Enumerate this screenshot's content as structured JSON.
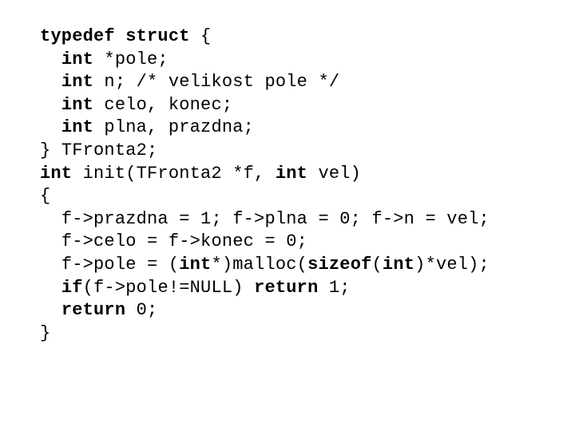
{
  "code": {
    "lines": [
      {
        "indent": 0,
        "tokens": [
          {
            "t": "typedef ",
            "kw": true
          },
          {
            "t": "struct ",
            "kw": true
          },
          {
            "t": "{",
            "kw": false
          }
        ]
      },
      {
        "indent": 1,
        "tokens": [
          {
            "t": "int ",
            "kw": true
          },
          {
            "t": "*pole;",
            "kw": false
          }
        ]
      },
      {
        "indent": 1,
        "tokens": [
          {
            "t": "int ",
            "kw": true
          },
          {
            "t": "n; /* velikost pole */",
            "kw": false
          }
        ]
      },
      {
        "indent": 1,
        "tokens": [
          {
            "t": "int ",
            "kw": true
          },
          {
            "t": "celo, konec;",
            "kw": false
          }
        ]
      },
      {
        "indent": 1,
        "tokens": [
          {
            "t": "int ",
            "kw": true
          },
          {
            "t": "plna, prazdna;",
            "kw": false
          }
        ]
      },
      {
        "indent": 0,
        "tokens": [
          {
            "t": "} TFronta2;",
            "kw": false
          }
        ]
      },
      {
        "indent": 0,
        "tokens": [
          {
            "t": "",
            "kw": false
          }
        ]
      },
      {
        "indent": 0,
        "tokens": [
          {
            "t": "int ",
            "kw": true
          },
          {
            "t": "init(TFronta2 *f, ",
            "kw": false
          },
          {
            "t": "int ",
            "kw": true
          },
          {
            "t": "vel)",
            "kw": false
          }
        ]
      },
      {
        "indent": 0,
        "tokens": [
          {
            "t": "{",
            "kw": false
          }
        ]
      },
      {
        "indent": 1,
        "tokens": [
          {
            "t": "f->prazdna = 1; f->plna = 0; f->n = vel;",
            "kw": false
          }
        ]
      },
      {
        "indent": 1,
        "tokens": [
          {
            "t": "f->celo = f->konec = 0;",
            "kw": false
          }
        ]
      },
      {
        "indent": 1,
        "tokens": [
          {
            "t": "f->pole = (",
            "kw": false
          },
          {
            "t": "int",
            "kw": true
          },
          {
            "t": "*)malloc(",
            "kw": false
          },
          {
            "t": "sizeof",
            "kw": true
          },
          {
            "t": "(",
            "kw": false
          },
          {
            "t": "int",
            "kw": true
          },
          {
            "t": ")*vel);",
            "kw": false
          }
        ]
      },
      {
        "indent": 1,
        "tokens": [
          {
            "t": "if",
            "kw": true
          },
          {
            "t": "(f->pole!=NULL) ",
            "kw": false
          },
          {
            "t": "return ",
            "kw": true
          },
          {
            "t": "1;",
            "kw": false
          }
        ]
      },
      {
        "indent": 1,
        "tokens": [
          {
            "t": "return ",
            "kw": true
          },
          {
            "t": "0;",
            "kw": false
          }
        ]
      },
      {
        "indent": 0,
        "tokens": [
          {
            "t": "}",
            "kw": false
          }
        ]
      }
    ],
    "indent_unit": "  "
  }
}
